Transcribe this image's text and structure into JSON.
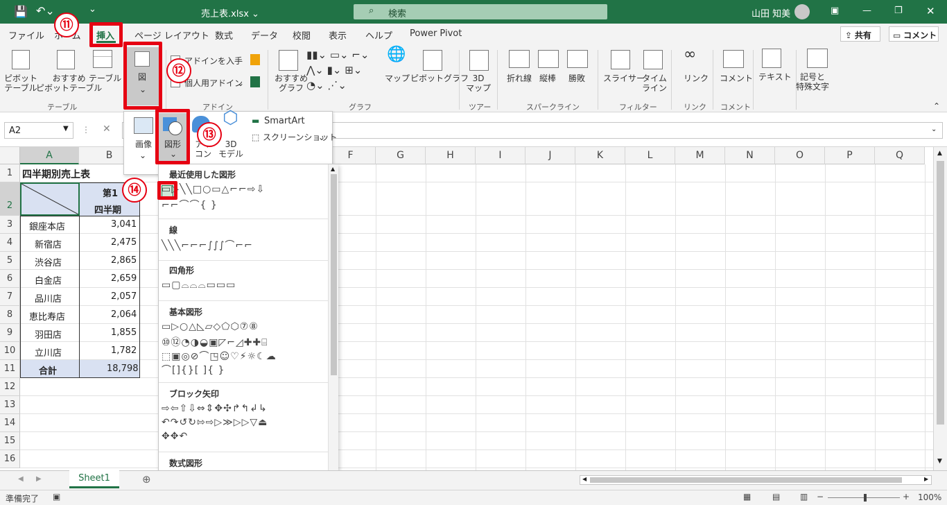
{
  "titlebar": {
    "filename": "売上表.xlsx ⌄",
    "search": "検索",
    "user": "山田 知美"
  },
  "tabs": [
    "ファイル",
    "ホーム",
    "挿入",
    "ページ レイアウト",
    "数式",
    "データ",
    "校閲",
    "表示",
    "ヘルプ",
    "Power Pivot"
  ],
  "share": "共有",
  "comment": "コメント",
  "ribbon": {
    "pivot": "ピボット\nテーブル",
    "recpivot": "おすすめ\nピボットテーブル",
    "table": "テーブル",
    "illust": "図",
    "getaddin": "アドインを入手",
    "myaddin": "個人用アドイン",
    "recchart": "おすすめ\nグラフ",
    "map": "マップ",
    "pivotchart": "ピボットグラフ",
    "map3d": "3D\nマップ",
    "line": "折れ線",
    "column": "縦棒",
    "winloss": "勝敗",
    "slicer": "スライサー",
    "timeline": "タイム\nライン",
    "link": "リンク",
    "comment": "コメント",
    "text": "テキスト",
    "symbol": "記号と\n特殊文字"
  },
  "groups": {
    "table": "テーブル",
    "addin": "アドイン",
    "chart": "グラフ",
    "tour": "ツアー",
    "spark": "スパークライン",
    "filter": "フィルター",
    "link": "リンク",
    "comment": "コメント"
  },
  "namebox": "A2",
  "illustmenu": {
    "image": "画像",
    "shapes": "図形",
    "icons": "アイ\nコン",
    "model3d": "3D\nモデル",
    "smartart": "SmartArt",
    "screenshot": "スクリーンショット"
  },
  "columns": [
    "A",
    "B",
    "C",
    "D",
    "E",
    "F",
    "G",
    "H",
    "I",
    "J",
    "K",
    "L",
    "M",
    "N",
    "O",
    "P",
    "Q"
  ],
  "sheet": {
    "title": "四半期別売上表",
    "header": [
      "第1",
      "四半期"
    ],
    "rows": [
      [
        "銀座本店",
        "3,041"
      ],
      [
        "新宿店",
        "2,475"
      ],
      [
        "渋谷店",
        "2,865"
      ],
      [
        "白金店",
        "2,659"
      ],
      [
        "品川店",
        "2,057"
      ],
      [
        "恵比寿店",
        "2,064"
      ],
      [
        "羽田店",
        "1,855"
      ],
      [
        "立川店",
        "1,782"
      ],
      [
        "合計",
        "18,798"
      ]
    ]
  },
  "rownums": [
    "1",
    "2",
    "3",
    "4",
    "5",
    "6",
    "7",
    "8",
    "9",
    "10",
    "11",
    "12",
    "13",
    "14",
    "15",
    "16"
  ],
  "shapes": {
    "recent": "最近使用した図形",
    "lines": "線",
    "rect": "四角形",
    "basic": "基本図形",
    "block": "ブロック矢印",
    "equation": "数式図形",
    "recent_r1": "▭▷╲╲□○▭△⌐⌐⇨⇩",
    "recent_r2": "⌐⌐⌒⌒{ }",
    "lines_r1": "╲╲╲⌐⌐⌐∫∫∫⌒⌐⌐",
    "rect_r1": "▭▢⌓⌓⌓▭▭▭",
    "basic_r1": "▭▷○△◺▱◇⬠⬡⑦⑧",
    "basic_r2": "⑩⑫◔◑◒▣◸⌐◿✚✚⌸",
    "basic_r3": "⬚▣◎⊘⌒◳☺♡⚡☼☾☁",
    "basic_r4": "⌒[]{}[ ]{ }",
    "block_r1": "⇨⇦⇧⇩⇔⇕✥✣↱↰↲↳",
    "block_r2": "↶↷↺↻⇰⇨▷≫▷▷▽⏏",
    "block_r3": "✥✥↶",
    "eq_r1": "✚━✖➗═≠"
  },
  "sheettab": "Sheet1",
  "status": {
    "ready": "準備完了",
    "zoom": "100%"
  },
  "badges": [
    "⑪",
    "⑫",
    "⑬",
    "⑭"
  ],
  "colors": {
    "green": "#217346",
    "red": "#e60012"
  }
}
